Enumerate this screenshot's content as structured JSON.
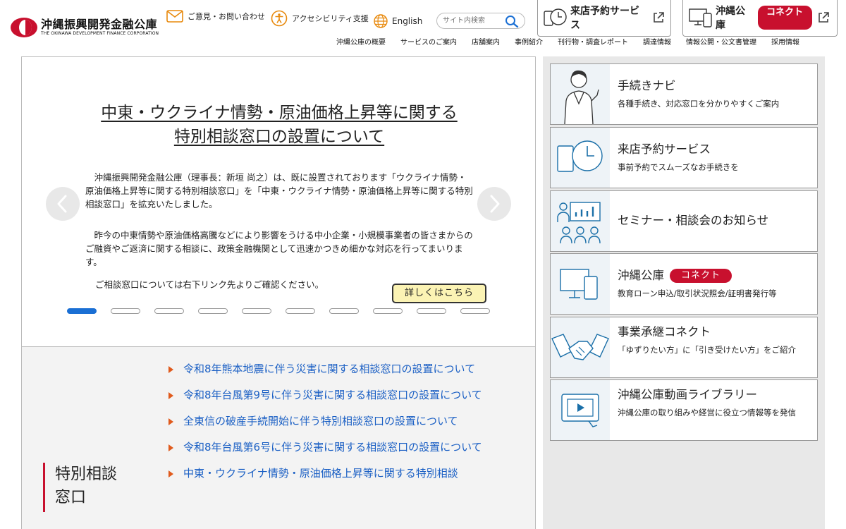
{
  "header": {
    "logo_ja": "沖縄振興開発金融公庫",
    "logo_en": "THE OKINAWA DEVELOPMENT FINANCE CORPORATION",
    "utility": {
      "contact": "ご意見・お問い合わせ",
      "accessibility": "アクセシビリティ支援",
      "english": "English"
    },
    "search": {
      "placeholder": "サイト内検索"
    },
    "yoyaku_box": "来店予約サービス",
    "connect_box": {
      "label": "沖縄公庫",
      "badge": "コネクト"
    },
    "global_nav": [
      "沖縄公庫の概要",
      "サービスのご案内",
      "店舗案内",
      "事例紹介",
      "刊行物・調査レポート",
      "調達情報",
      "情報公開・公文書管理",
      "採用情報"
    ]
  },
  "hero": {
    "title_line1": "中東・ウクライナ情勢・原油価格上昇等に関する",
    "title_line2": "特別相談窓口の設置について",
    "paragraph1": "　沖縄振興開発金融公庫（理事長：新垣 尚之）は、既に設置されております「ウクライナ情勢・原油価格上昇等に関する特別相談窓口」を「中東・ウクライナ情勢・原油価格上昇等に関する特別相談窓口」を拡充いたしました。",
    "paragraph2": "　昨今の中東情勢や原油価格高騰などにより影響をうける中小企業・小規模事業者の皆さまからのご融資やご返済に関する相談に、政策金融機関として迅速かつきめ細かな対応を行ってまいります。",
    "paragraph3": "ご相談窓口については右下リンク先よりご確認ください。",
    "detail_button": "詳しくはこちら",
    "slide_count": 10,
    "active_slide": 1
  },
  "notice": {
    "heading_line1": "特別相談",
    "heading_line2": "窓口",
    "items": [
      "令和8年熊本地震に伴う災害に関する相談窓口の設置について",
      "令和8年台風第9号に伴う災害に関する相談窓口の設置について",
      "全東信の破産手続開始に伴う特別相談窓口の設置について",
      "令和8年台風第6号に伴う災害に関する相談窓口の設置について",
      "中東・ウクライナ情勢・原油価格上昇等に関する特別相談"
    ]
  },
  "side_cards": [
    {
      "title": "手続きナビ",
      "sub": "各種手続き、対応窓口を分かりやすくご案内",
      "icon": "person-guide-icon"
    },
    {
      "title": "来店予約サービス",
      "sub": "事前予約でスムーズなお手続きを",
      "icon": "clock-tablet-icon"
    },
    {
      "title": "セミナー・相談会のお知らせ",
      "sub": "",
      "icon": "seminar-icon"
    },
    {
      "title": "沖縄公庫",
      "badge": "コネクト",
      "sub": "教育ローン申込/取引状況照会/証明書発行等",
      "icon": "devices-icon"
    },
    {
      "title": "事業承継コネクト",
      "sub": "「ゆずりたい方」に「引き受けたい方」をご紹介",
      "icon": "handshake-icon"
    },
    {
      "title": "沖縄公庫動画ライブラリー",
      "sub": "沖縄公庫の取り組みや経営に役立つ情報等を発信",
      "icon": "video-icon"
    }
  ],
  "colors": {
    "brand_red": "#c8102e",
    "link_blue": "#1a5fc4",
    "dot_active": "#1a6fd4",
    "button_yellow": "#fbf3b4",
    "accent_orange": "#e05a1c",
    "side_bg": "#e8e8e8",
    "notice_bg": "#f3f3f3"
  }
}
